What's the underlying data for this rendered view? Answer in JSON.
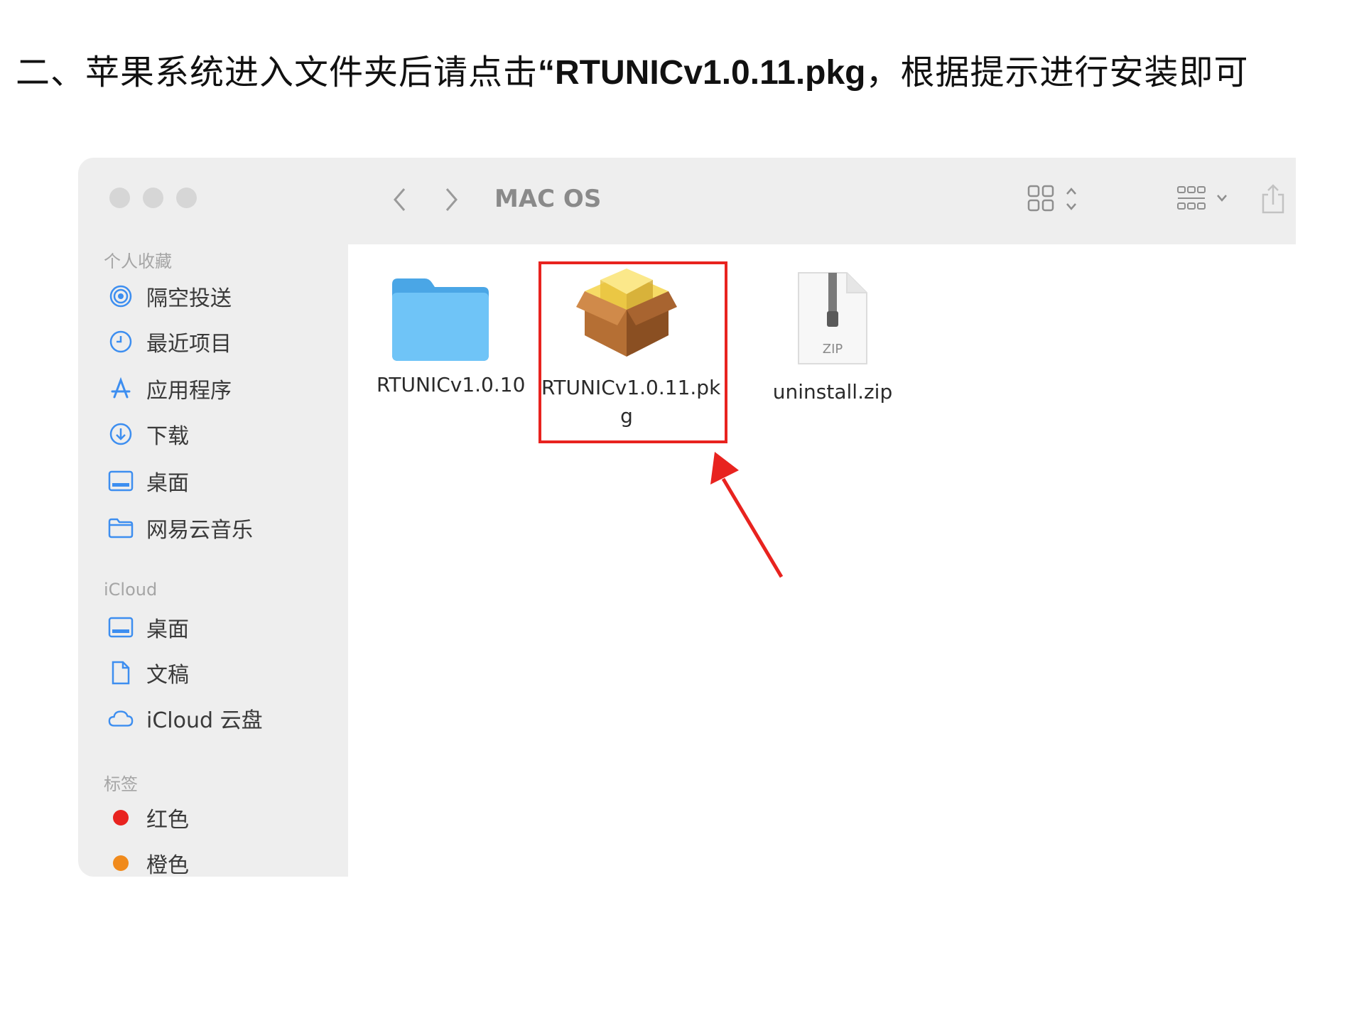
{
  "instruction": {
    "prefix": "二、苹果系统进入文件夹后请点击",
    "highlight": "“RTUNICv1.0.11.pkg",
    "suffix": "，根据提示进行安装即可"
  },
  "toolbar": {
    "title": "MAC OS",
    "back_icon": "chevron-left-icon",
    "forward_icon": "chevron-right-icon",
    "view_icon": "grid-view-icon",
    "group_icon": "group-by-icon",
    "share_icon": "share-icon"
  },
  "sidebar": {
    "sections": [
      {
        "header": "个人收藏",
        "items": [
          {
            "label": "隔空投送",
            "icon": "airdrop-icon"
          },
          {
            "label": "最近项目",
            "icon": "clock-icon"
          },
          {
            "label": "应用程序",
            "icon": "applications-icon"
          },
          {
            "label": "下载",
            "icon": "download-icon"
          },
          {
            "label": "桌面",
            "icon": "desktop-icon"
          },
          {
            "label": "网易云音乐",
            "icon": "folder-icon"
          }
        ]
      },
      {
        "header": "iCloud",
        "items": [
          {
            "label": "桌面",
            "icon": "desktop-icon"
          },
          {
            "label": "文稿",
            "icon": "document-icon"
          },
          {
            "label": "iCloud 云盘",
            "icon": "cloud-icon"
          }
        ]
      },
      {
        "header": "标签",
        "items": [
          {
            "label": "红色",
            "icon": "tag-dot-icon",
            "color": "#e8231f"
          },
          {
            "label": "橙色",
            "icon": "tag-dot-icon",
            "color": "#f08a1c"
          }
        ]
      }
    ]
  },
  "files": [
    {
      "name": "RTUNICv1.0.10",
      "icon": "folder-icon"
    },
    {
      "name_line1": "RTUNICv1.0.11.pk",
      "name_line2": "g",
      "icon": "package-icon",
      "selected": true
    },
    {
      "name": "uninstall.zip",
      "icon": "zip-file-icon",
      "badge": "ZIP"
    }
  ],
  "colors": {
    "highlight_box": "#e8231f",
    "folder_blue": "#5ab6f0",
    "sidebar_bg": "#eeeeee"
  }
}
